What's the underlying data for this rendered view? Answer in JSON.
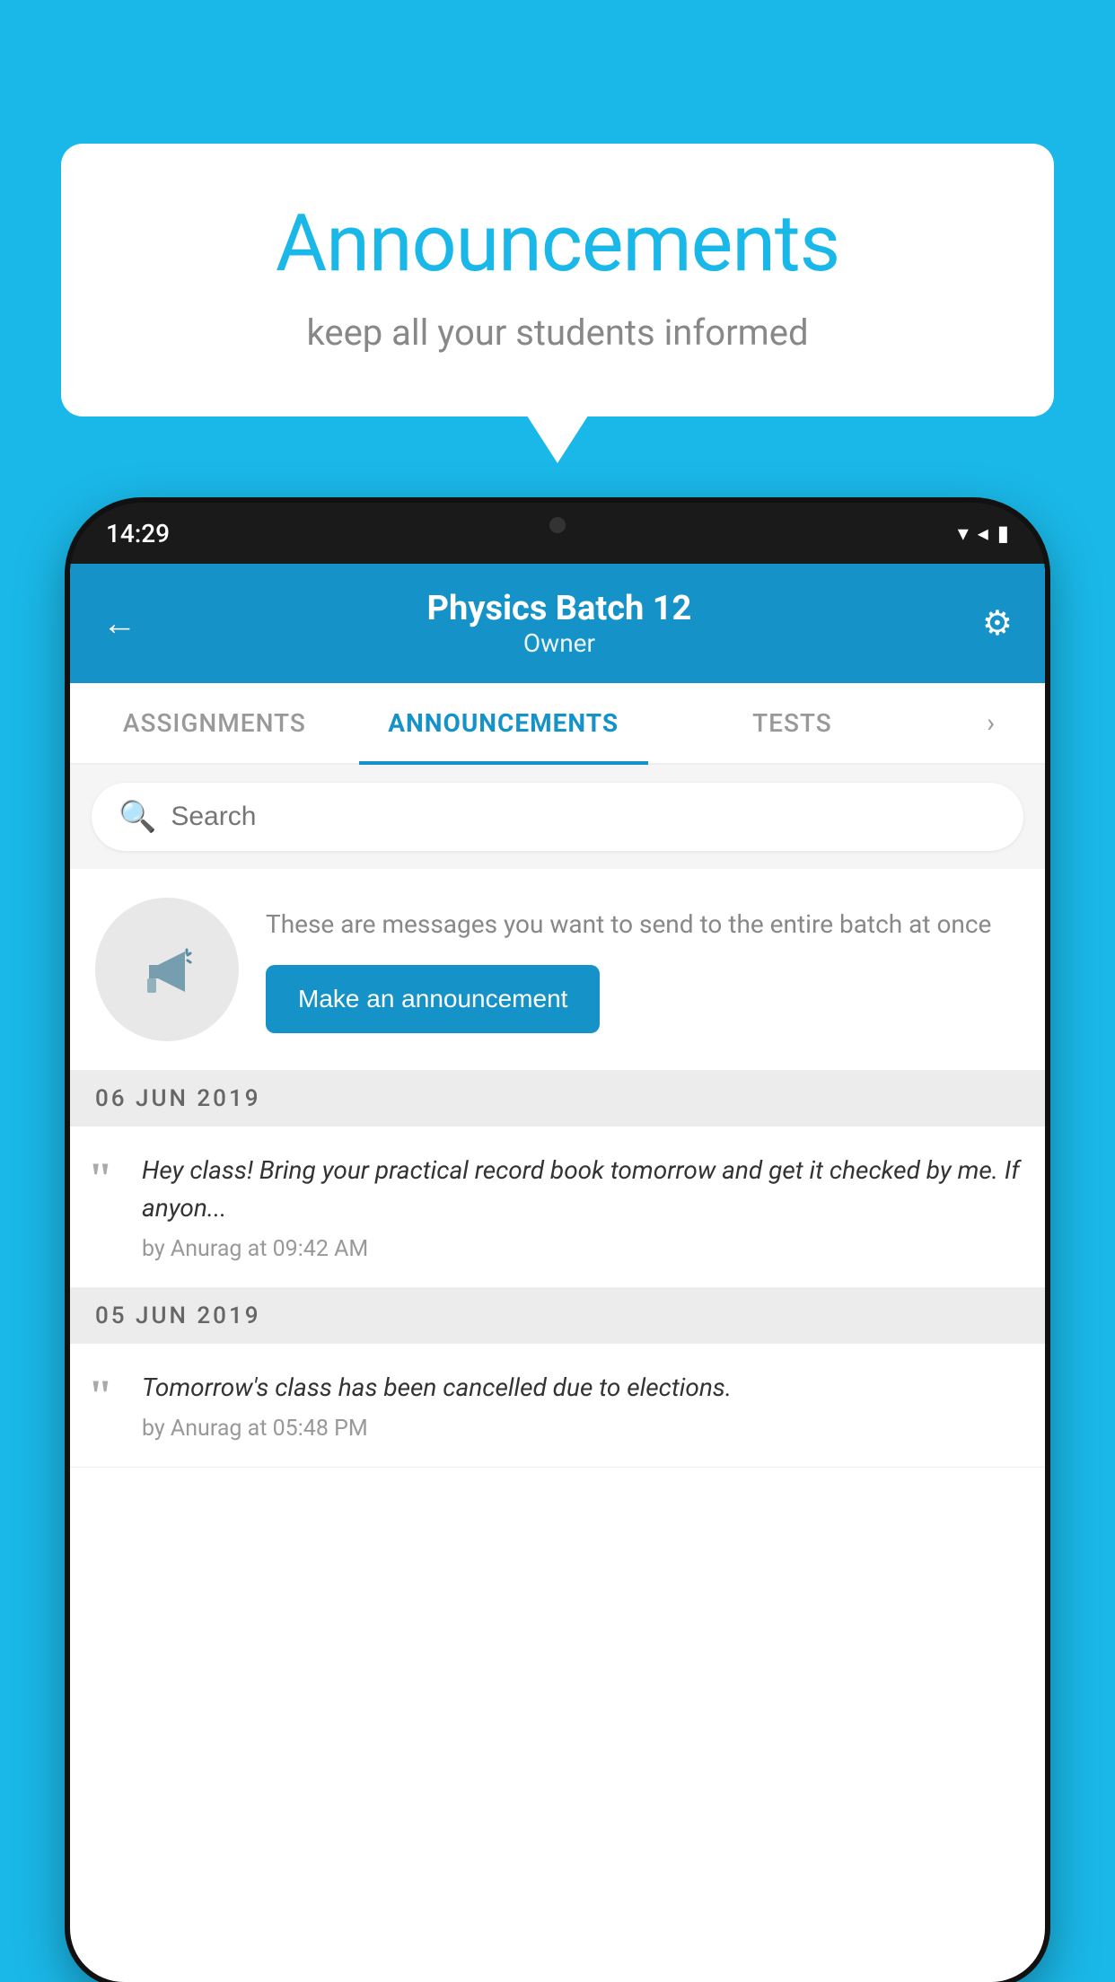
{
  "page": {
    "background_color": "#1AB8E8"
  },
  "speech_bubble": {
    "title": "Announcements",
    "subtitle": "keep all your students informed"
  },
  "phone": {
    "status_bar": {
      "time": "14:29"
    },
    "app_bar": {
      "title": "Physics Batch 12",
      "subtitle": "Owner",
      "back_label": "←",
      "settings_label": "⚙"
    },
    "tabs": [
      {
        "label": "ASSIGNMENTS",
        "active": false
      },
      {
        "label": "ANNOUNCEMENTS",
        "active": true
      },
      {
        "label": "TESTS",
        "active": false
      }
    ],
    "search": {
      "placeholder": "Search"
    },
    "announcement_promo": {
      "description": "These are messages you want to send to the entire batch at once",
      "button_label": "Make an announcement"
    },
    "announcements": [
      {
        "date": "06  JUN  2019",
        "text": "Hey class! Bring your practical record book tomorrow and get it checked by me. If anyon...",
        "meta": "by Anurag at 09:42 AM"
      },
      {
        "date": "05  JUN  2019",
        "text": "Tomorrow's class has been cancelled due to elections.",
        "meta": "by Anurag at 05:48 PM"
      }
    ]
  }
}
